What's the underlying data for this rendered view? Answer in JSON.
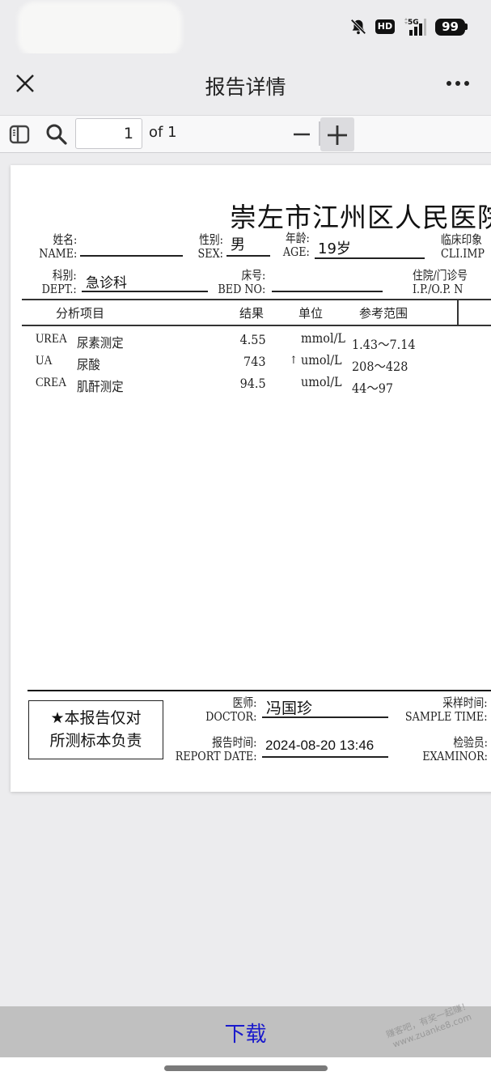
{
  "status_bar": {
    "icons": [
      "bell-muted-icon",
      "hd-icon",
      "5g-signal-icon",
      "battery-icon"
    ],
    "hd_label": "HD",
    "network_label": "5G",
    "battery_level": "99"
  },
  "nav": {
    "close_icon": "close-icon",
    "title": "报告详情",
    "more_icon": "more-icon"
  },
  "toolbar": {
    "sidebar_icon": "sidebar-toggle-icon",
    "search_icon": "search-icon",
    "page_value": "1",
    "page_total_label": "of 1",
    "zoom_out_icon": "minus-icon",
    "zoom_in_icon": "plus-icon"
  },
  "report": {
    "hospital_name": "崇左市江州区人民医院",
    "fields": {
      "name_cn": "姓名:",
      "name_en": "NAME:",
      "name_value": "",
      "sex_cn": "性别:",
      "sex_en": "SEX:",
      "sex_value": "男",
      "age_cn": "年龄:",
      "age_en": "AGE:",
      "age_value": "19岁",
      "clinical_cn": "临床印象",
      "clinical_en": "CLI.IMP",
      "dept_cn": "科别:",
      "dept_en": "DEPT.:",
      "dept_value": "急诊科",
      "bed_cn": "床号:",
      "bed_en": "BED NO:",
      "bed_value": "",
      "ipop_cn": "住院/门诊号",
      "ipop_en": "I.P./O.P. N"
    },
    "columns": {
      "item": "分析项目",
      "result": "结果",
      "unit": "单位",
      "reference": "参考范围"
    },
    "rows": [
      {
        "code": "UREA",
        "name": "尿素测定",
        "result": "4.55",
        "flag": "",
        "unit": "mmol/L",
        "reference": "1.43～7.14"
      },
      {
        "code": "UA",
        "name": "尿酸",
        "result": "743",
        "flag": "↑",
        "unit": "umol/L",
        "reference": "208～428"
      },
      {
        "code": "CREA",
        "name": "肌酐测定",
        "result": "94.5",
        "flag": "",
        "unit": "umol/L",
        "reference": "44～97"
      }
    ],
    "footer": {
      "note_line1": "★本报告仅对",
      "note_line2": "所测标本负责",
      "doctor_cn": "医师:",
      "doctor_en": "DOCTOR:",
      "doctor_value": "冯国珍",
      "sample_time_cn": "采样时间:",
      "sample_time_en": "SAMPLE TIME:",
      "report_date_cn": "报告时间:",
      "report_date_en": "REPORT DATE:",
      "report_date_value": "2024-08-20 13:46",
      "examiner_cn": "检验员:",
      "examiner_en": "EXAMINOR:"
    }
  },
  "bottom": {
    "download_label": "下载",
    "watermark_line1": "赚客吧，有奖一起赚！",
    "watermark_line2": "www.zuanke8.com"
  }
}
